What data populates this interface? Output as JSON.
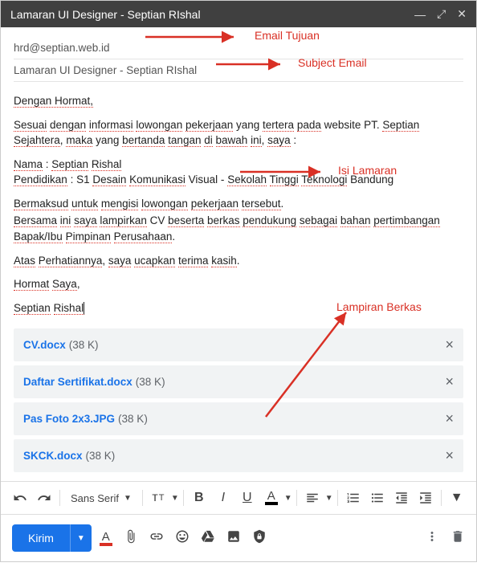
{
  "header": {
    "title": "Lamaran UI Designer - Septian RIshal"
  },
  "recipient": "hrd@septian.web.id",
  "subject": "Lamaran UI Designer - Septian RIshal",
  "body": {
    "greeting": "Dengan Hormat,",
    "p1a": "Sesuai dengan informasi lowongan pekerjaan yang tertera pada website PT. Septian Sejahtera, maka yang bertanda tangan di bawah ini, saya :",
    "nama_label": "Nama",
    "nama_value": "Septian Rishal",
    "pend_label": "Pendidikan",
    "pend_value": "S1 Desain Komunikasi Visual - Sekolah Tinggi Teknologi Bandung",
    "p3": "Bermaksud untuk mengisi lowongan pekerjaan tersebut.",
    "p4": "Bersama ini saya lampirkan CV beserta berkas pendukung sebagai bahan pertimbangan Bapak/Ibu Pimpinan Perusahaan.",
    "p5": "Atas Perhatiannya, saya ucapkan terima kasih.",
    "closing": "Hormat Saya,",
    "signature": "Septian Rishal"
  },
  "attachments": [
    {
      "name": "CV.docx",
      "size": "(38 K)"
    },
    {
      "name": "Daftar Sertifikat.docx",
      "size": "(38 K)"
    },
    {
      "name": "Pas Foto 2x3.JPG",
      "size": "(38 K)"
    },
    {
      "name": "SKCK.docx",
      "size": "(38 K)"
    }
  ],
  "toolbar": {
    "font": "Sans Serif"
  },
  "footer": {
    "send": "Kirim"
  },
  "annotations": {
    "email_tujuan": "Email Tujuan",
    "subject_email": "Subject Email",
    "isi_lamaran": "Isi Lamaran",
    "lampiran_berkas": "Lampiran Berkas"
  }
}
